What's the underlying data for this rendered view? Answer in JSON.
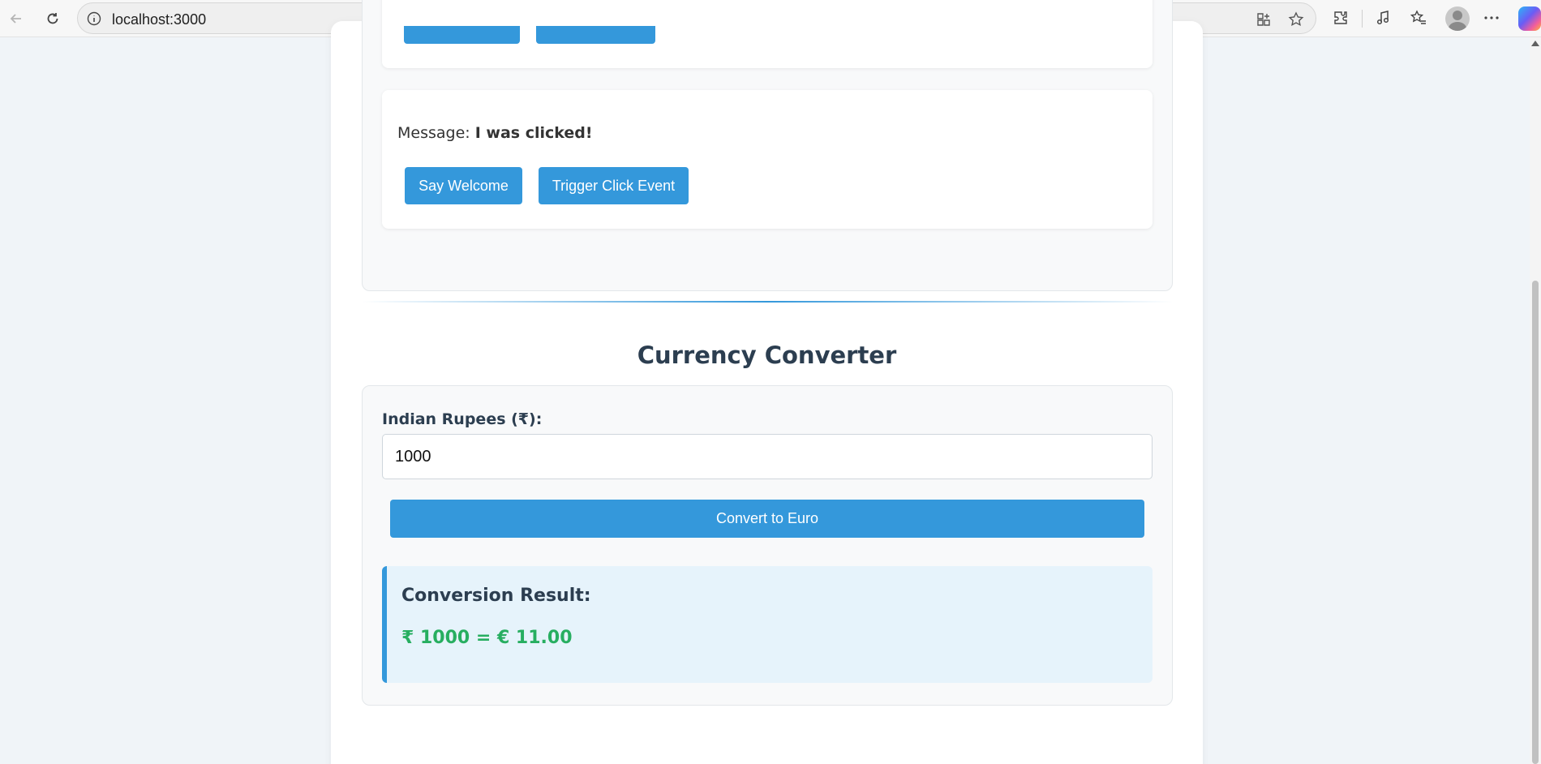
{
  "browser": {
    "url": "localhost:3000"
  },
  "events_section": {
    "message_label": "Message:",
    "message_value": "I was clicked!",
    "say_welcome_label": "Say Welcome",
    "trigger_click_label": "Trigger Click Event"
  },
  "converter": {
    "title": "Currency Converter",
    "input_label": "Indian Rupees (₹):",
    "input_value": "1000",
    "convert_button_label": "Convert to Euro",
    "result_title": "Conversion Result:",
    "result_text": "₹ 1000 = € 11.00"
  },
  "colors": {
    "accent": "#3498db",
    "heading": "#2c3e50",
    "result_value": "#27ae60",
    "result_bg": "#e6f3fb"
  }
}
